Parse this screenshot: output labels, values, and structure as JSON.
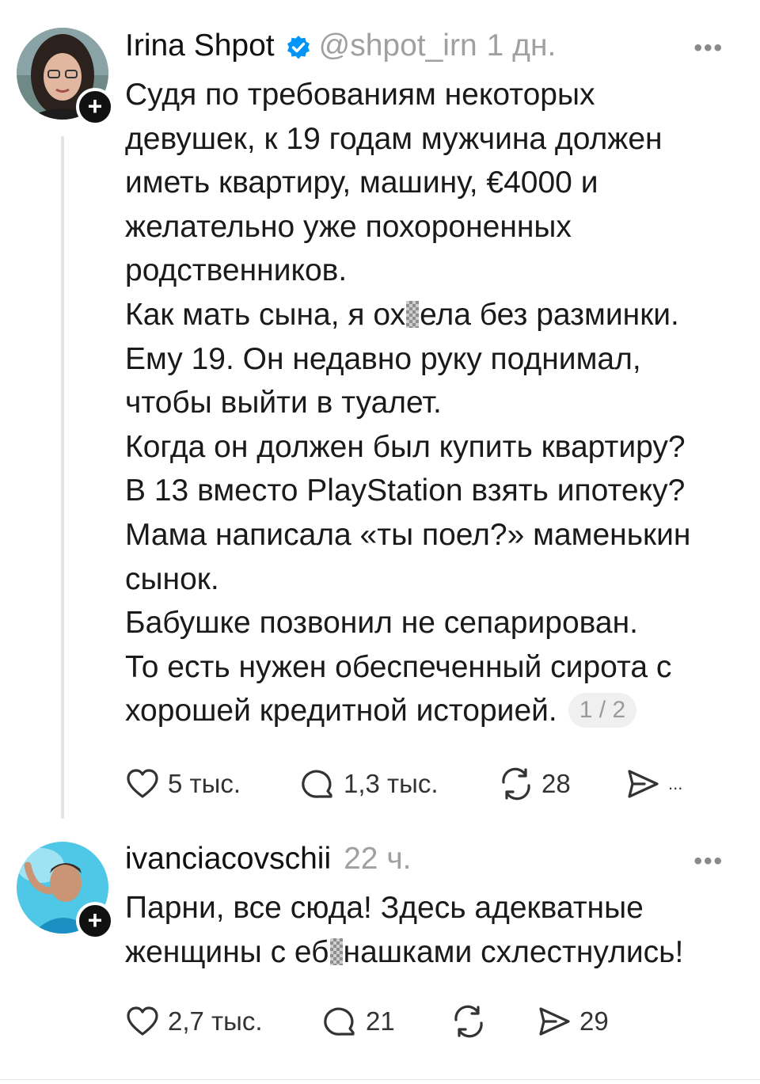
{
  "post1": {
    "username": "Irina Shpot",
    "handle": "@shpot_irn",
    "time": "1 дн.",
    "more": "•••",
    "lines": [
      "Судя по требованиям некоторых",
      "девушек, к 19 годам мужчина должен",
      "иметь квартиру, машину, €4000 и",
      "желательно уже похороненных",
      "родственников.",
      {
        "a": "Как мать сына, я ох",
        "b": "ела без разминки."
      },
      "Ему 19. Он недавно руку поднимал,",
      "чтобы выйти в туалет.",
      "Когда он должен был купить квартиру?",
      "В 13 вместо PlayStation взять ипотеку?",
      "Мама написала «ты поел?» маменькин",
      "сынок.",
      "Бабушке позвонил не сепарирован.",
      "То есть нужен обеспеченный сирота с",
      "хорошей кредитной историей."
    ],
    "page_indicator": "1 / 2",
    "likes": "5 тыс.",
    "replies": "1,3 тыс.",
    "reposts": "28",
    "shares": "..."
  },
  "post2": {
    "username": "ivanciacovschii",
    "time": "22 ч.",
    "more": "•••",
    "lines": [
      "Парни, все сюда! Здесь адекватные",
      {
        "a": "женщины с еб",
        "b": "нашками схлестнулись!"
      }
    ],
    "likes": "2,7 тыс.",
    "replies": "21",
    "reposts": "",
    "shares": "29"
  },
  "colors": {
    "verified": "#0095f6",
    "muted": "#a0a0a0",
    "text": "#1a1a1a"
  },
  "icons": {
    "like": "heart-icon",
    "reply": "speech-bubble-icon",
    "repost": "repost-icon",
    "share": "paper-plane-icon",
    "follow": "plus-icon"
  }
}
